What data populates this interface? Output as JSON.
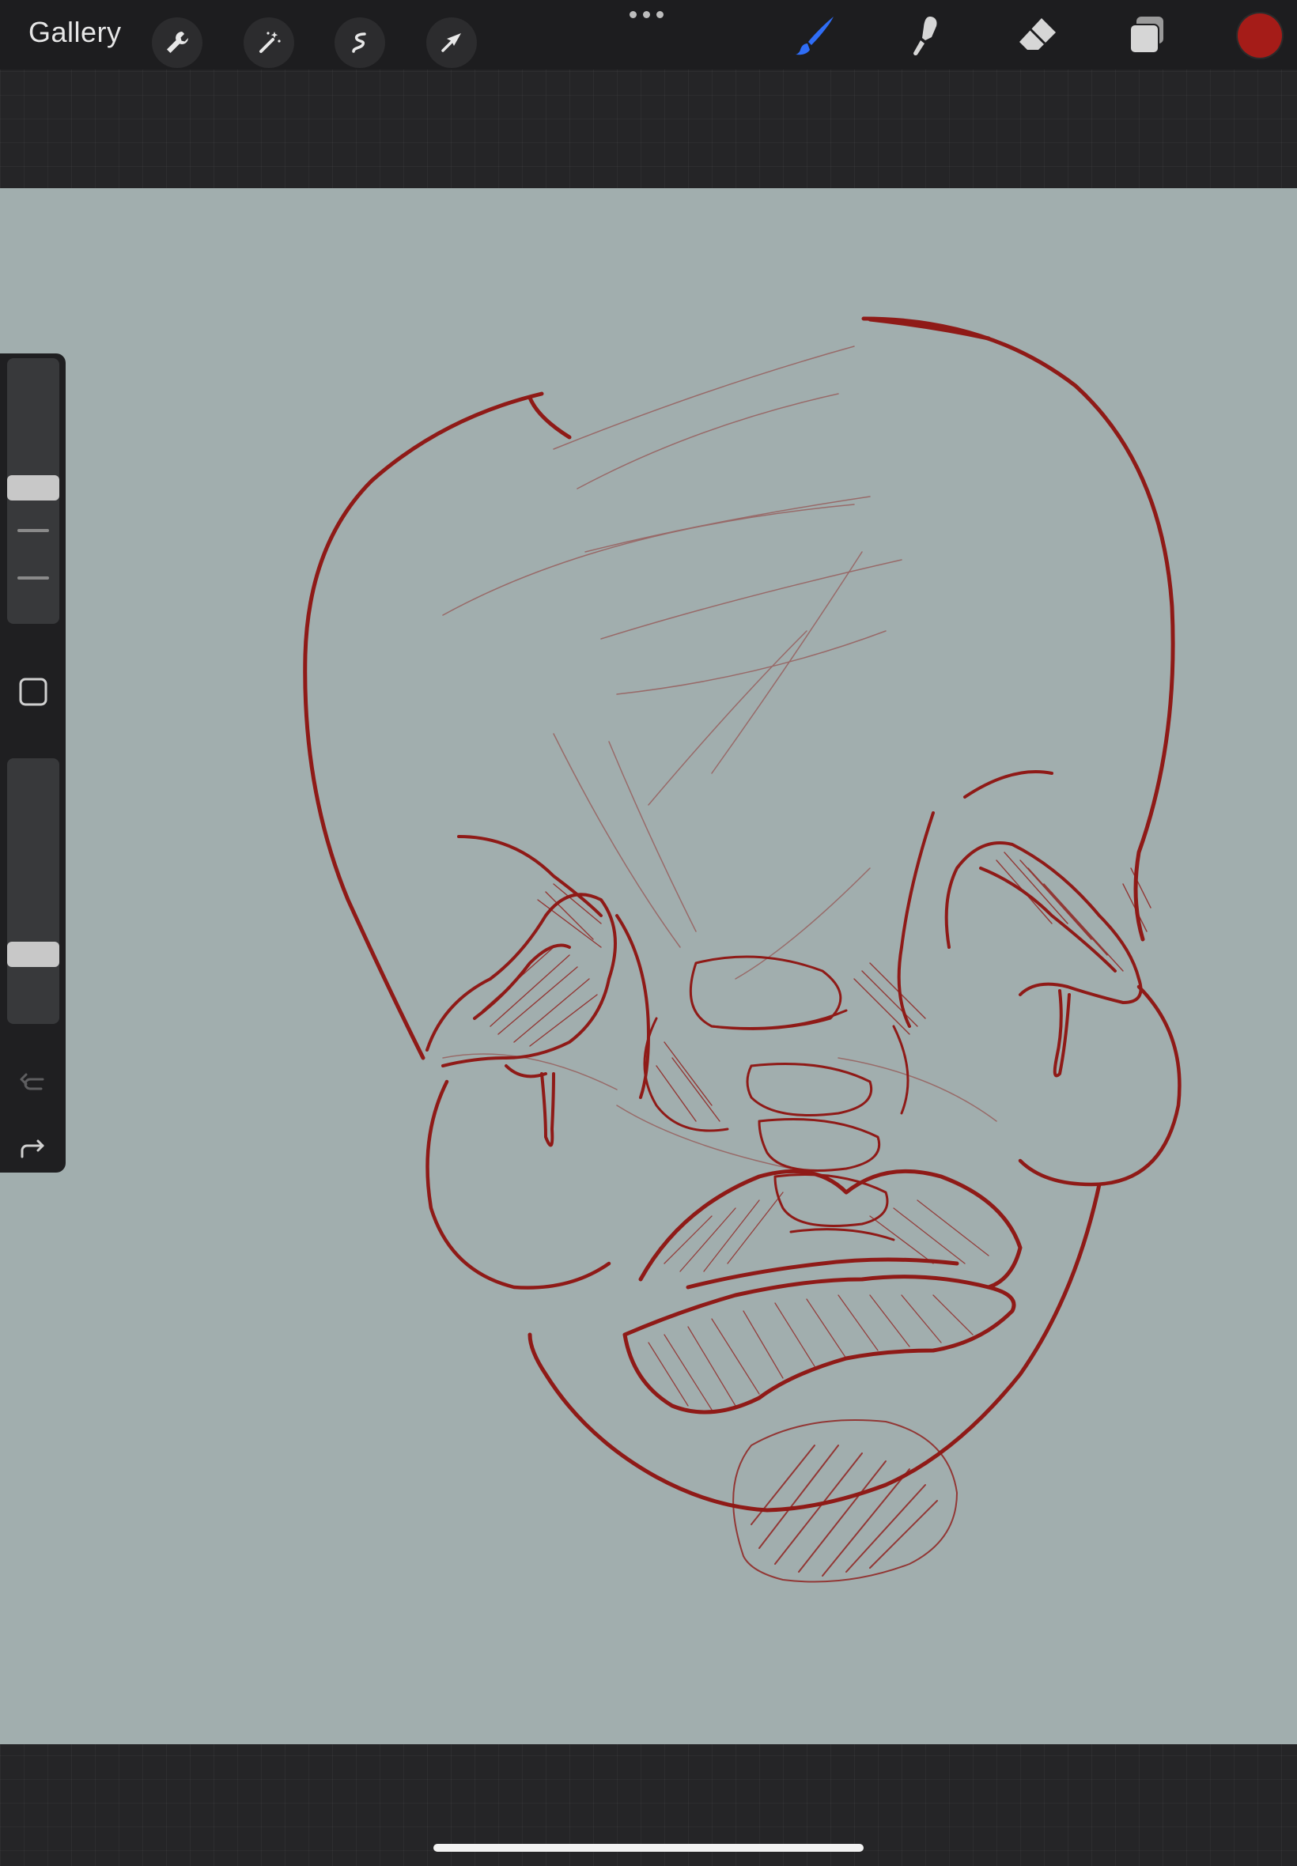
{
  "toolbar": {
    "gallery_label": "Gallery",
    "left_tools": [
      "wrench-icon",
      "magic-wand-icon",
      "selection-icon",
      "transform-arrow-icon"
    ],
    "right_tools": [
      "brush-icon",
      "smudge-icon",
      "eraser-icon",
      "layers-icon"
    ],
    "active_tool": "brush-icon",
    "accent_color": "#2f6df6",
    "current_color": "#a51c18"
  },
  "canvas": {
    "background_color": "#a1aeae",
    "stroke_color": "#8f1a17"
  },
  "sidebar": {
    "brush_size": 0.48,
    "brush_opacity": 0.72,
    "buttons": [
      "modify-square-icon",
      "undo-icon",
      "redo-icon"
    ]
  }
}
